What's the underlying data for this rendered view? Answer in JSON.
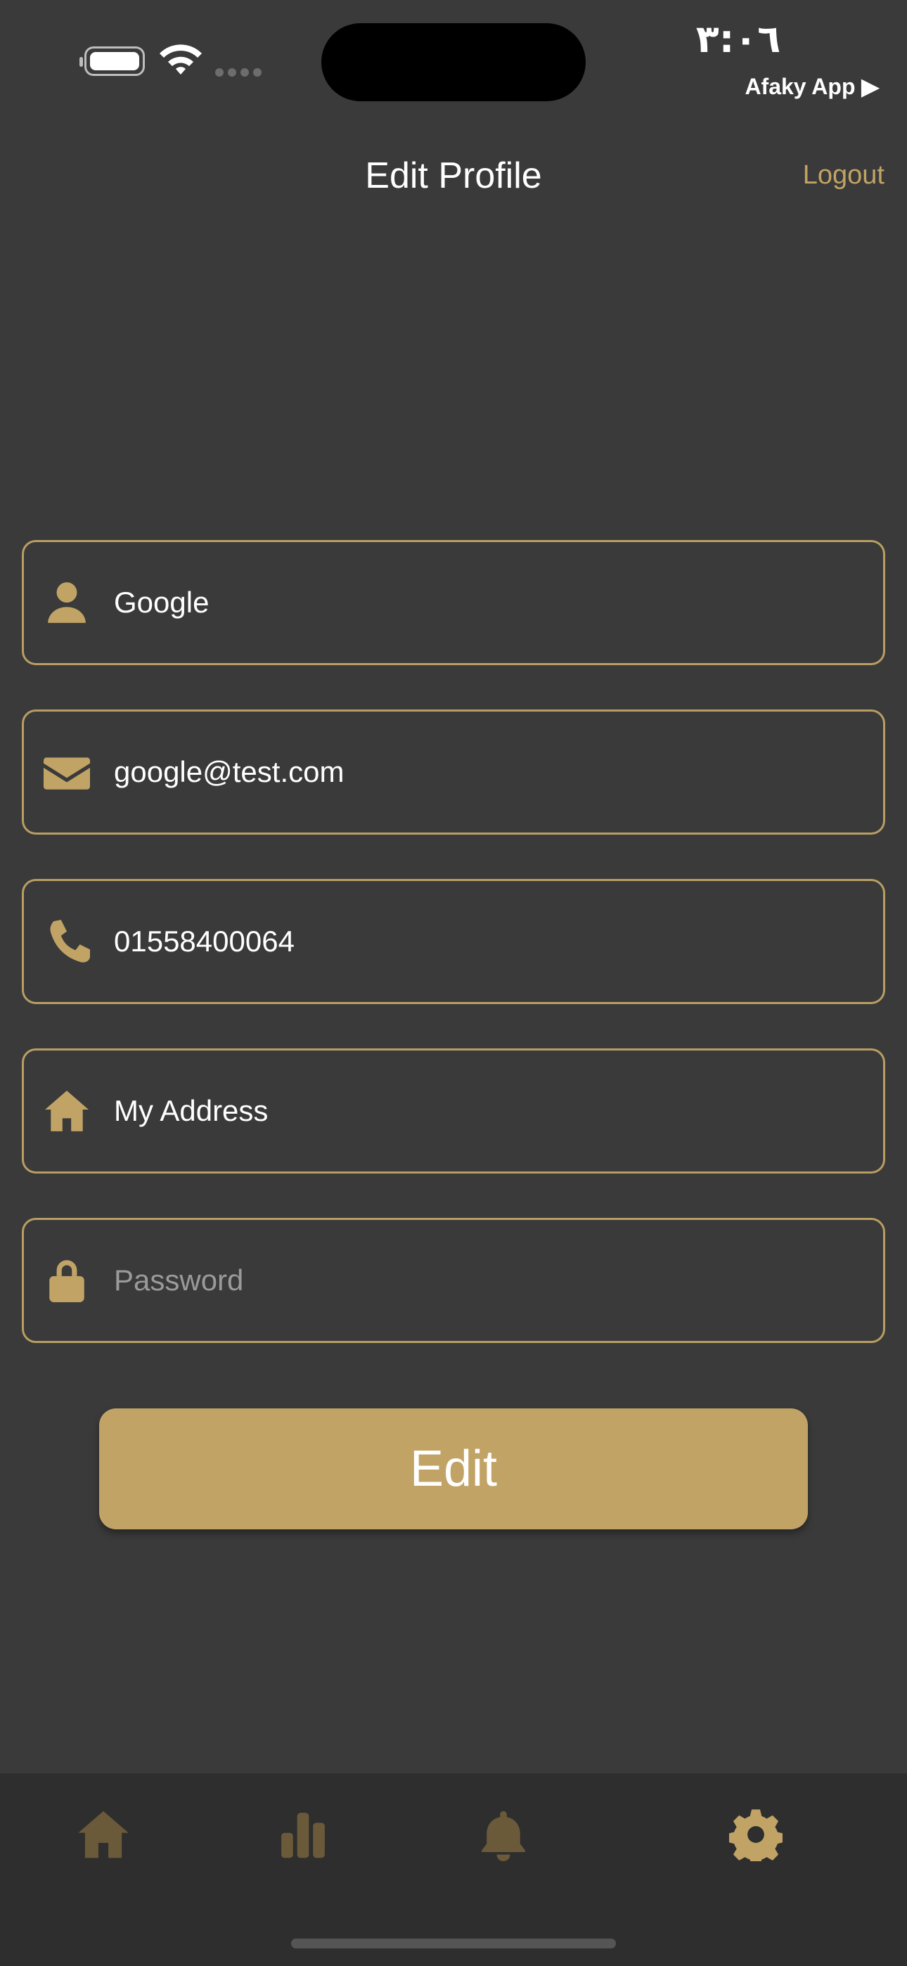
{
  "status_bar": {
    "time": "٣:٠٦",
    "back_to_app": "Afaky App ▶"
  },
  "header": {
    "title": "Edit Profile",
    "logout_label": "Logout"
  },
  "form": {
    "name": {
      "value": "Google",
      "icon": "user-icon"
    },
    "email": {
      "value": "google@test.com",
      "icon": "envelope-icon"
    },
    "phone": {
      "value": "01558400064",
      "icon": "phone-icon"
    },
    "address": {
      "value": "My Address",
      "icon": "home-icon"
    },
    "password": {
      "value": "",
      "placeholder": "Password",
      "icon": "lock-icon"
    }
  },
  "edit_button_label": "Edit",
  "tab_bar": {
    "tabs": [
      {
        "icon": "home-icon",
        "active": false
      },
      {
        "icon": "bar-chart-icon",
        "active": false
      },
      {
        "icon": "bell-icon",
        "active": false
      },
      {
        "icon": "gear-icon",
        "active": true
      }
    ],
    "active_color": "#c1a366",
    "inactive_color": "#6b5a3a"
  },
  "colors": {
    "background": "#3a3a3a",
    "accent": "#c1a366",
    "tab_bar_bg": "#2e2e2e"
  }
}
